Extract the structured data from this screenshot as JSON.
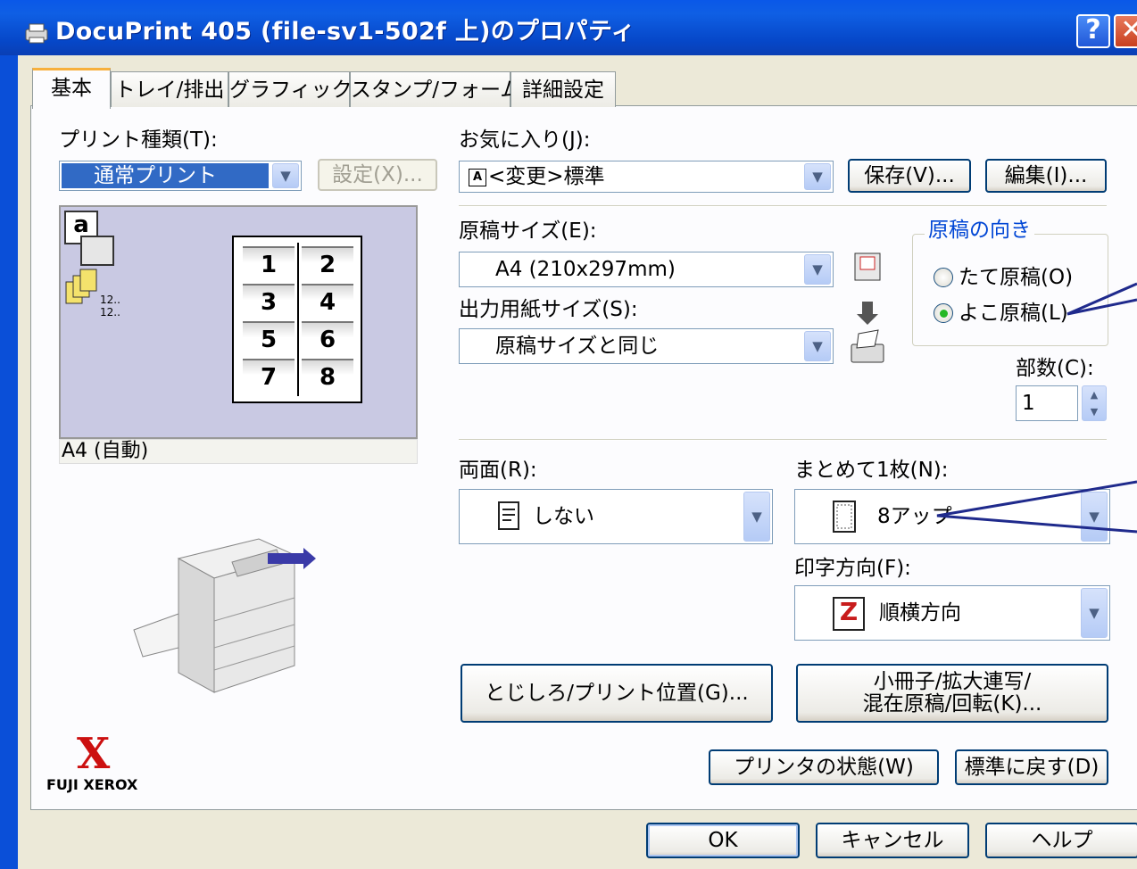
{
  "window": {
    "title": "DocuPrint 405 (file-sv1-502f 上)のプロパティ",
    "help_glyph": "?",
    "close_glyph": "✕"
  },
  "tabs": [
    {
      "label": "基本",
      "active": true
    },
    {
      "label": "トレイ/排出",
      "active": false
    },
    {
      "label": "グラフィックス",
      "active": false
    },
    {
      "label": "スタンプ/フォーム",
      "active": false
    },
    {
      "label": "詳細設定",
      "active": false
    }
  ],
  "left": {
    "print_type_label": "プリント種類(T):",
    "print_type_value": "通常プリント",
    "settings_button": "設定(X)...",
    "preview_caption": "A4 (自動)",
    "preview_icon_a": "a",
    "preview_icon_count": "12..",
    "preview_page_numbers": [
      "1",
      "2",
      "3",
      "4",
      "5",
      "6",
      "7",
      "8"
    ],
    "brand_mark": "X",
    "brand_text": "FUJI XEROX"
  },
  "favorites": {
    "label": "お気に入り(J):",
    "value": "<変更>標準",
    "value_icon_letter": "A",
    "save_button": "保存(V)...",
    "edit_button": "編集(I)..."
  },
  "paper": {
    "original_size_label": "原稿サイズ(E):",
    "original_size_value": "A4 (210x297mm)",
    "output_size_label": "出力用紙サイズ(S):",
    "output_size_value": "原稿サイズと同じ"
  },
  "orientation": {
    "group_title": "原稿の向き",
    "options": [
      {
        "label": "たて原稿(O)",
        "selected": false
      },
      {
        "label": "よこ原稿(L)",
        "selected": true
      }
    ]
  },
  "copies": {
    "label": "部数(C):",
    "value": "1"
  },
  "duplex": {
    "label": "両面(R):",
    "value": "しない"
  },
  "nup": {
    "label": "まとめて1枚(N):",
    "value": "8アップ"
  },
  "print_order": {
    "label": "印字方向(F):",
    "value": "順横方向"
  },
  "buttons": {
    "binding": "とじしろ/プリント位置(G)...",
    "booklet_line1": "小冊子/拡大連写/",
    "booklet_line2": "混在原稿/回転(K)...",
    "printer_status": "プリンタの状態(W)",
    "restore_defaults": "標準に戻す(D)",
    "ok": "OK",
    "cancel": "キャンセル",
    "help": "ヘルプ"
  },
  "colors": {
    "titlebar": "#0a58e8",
    "annotation_line": "#1f2a8c",
    "preview_bg": "#c9c9e3"
  }
}
